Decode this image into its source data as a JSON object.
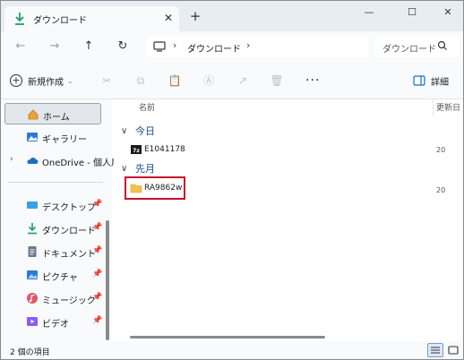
{
  "tab": {
    "title": "ダウンロード",
    "close": "✕",
    "new_tab": "+"
  },
  "window_controls": {
    "minimize": "—",
    "maximize": "☐",
    "close": "✕"
  },
  "nav": {
    "back": "←",
    "forward": "→",
    "up": "↑",
    "refresh": "↻"
  },
  "address": {
    "separator": "›",
    "crumb": "ダウンロード"
  },
  "search": {
    "placeholder": "ダウンロード"
  },
  "toolbar": {
    "new_label": "新規作成",
    "new_caret": "⌄",
    "more": "···",
    "details_label": "詳細"
  },
  "sidebar": {
    "items": [
      {
        "label": "ホーム",
        "icon": "home-icon",
        "selected": true
      },
      {
        "label": "ギャラリー",
        "icon": "gallery-icon"
      },
      {
        "label": "OneDrive - 個人用",
        "icon": "onedrive-icon",
        "expand": "›"
      },
      {
        "label": "デスクトップ",
        "icon": "desktop-icon",
        "pin": "📌"
      },
      {
        "label": "ダウンロード",
        "icon": "download-icon",
        "pin": "📌"
      },
      {
        "label": "ドキュメント",
        "icon": "documents-icon",
        "pin": "📌"
      },
      {
        "label": "ピクチャ",
        "icon": "pictures-icon",
        "pin": "📌"
      },
      {
        "label": "ミュージック",
        "icon": "music-icon",
        "pin": "📌"
      },
      {
        "label": "ビデオ",
        "icon": "videos-icon",
        "pin": "📌"
      }
    ]
  },
  "content": {
    "columns": {
      "name": "名前",
      "date": "更新日"
    },
    "groups": [
      {
        "title": "今日",
        "chevron": "∨",
        "files": [
          {
            "name": "E1041178",
            "type": "7z-archive",
            "date": "20"
          }
        ]
      },
      {
        "title": "先月",
        "chevron": "∨",
        "files": [
          {
            "name": "RA9862w",
            "type": "folder",
            "date": "20"
          }
        ]
      }
    ]
  },
  "status": {
    "count": "2 個の項目"
  },
  "colors": {
    "accent": "#1a4b8a",
    "highlight": "#c8102e",
    "folder": "#f4c04e"
  }
}
